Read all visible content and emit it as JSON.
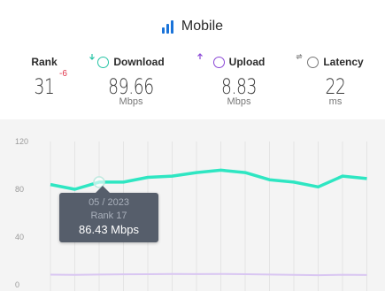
{
  "header": {
    "title": "Mobile",
    "icon": "signal-bars-icon"
  },
  "stats": {
    "rank": {
      "label": "Rank",
      "value": "31",
      "delta": "-6"
    },
    "download": {
      "label": "Download",
      "value": "89.66",
      "unit": "Mbps",
      "icon": "arrow-down-circle-icon",
      "color": "#27c4a5"
    },
    "upload": {
      "label": "Upload",
      "value": "8.83",
      "unit": "Mbps",
      "icon": "arrow-up-circle-icon",
      "color": "#8a47d6"
    },
    "latency": {
      "label": "Latency",
      "value": "22",
      "unit": "ms",
      "icon": "latency-circle-icon",
      "color": "#777777"
    }
  },
  "tooltip": {
    "date": "05 / 2023",
    "rank": "Rank 17",
    "value": "86.43 Mbps"
  },
  "chart_data": {
    "type": "line",
    "ylim": [
      0,
      120
    ],
    "y_ticks": [
      "120",
      "80",
      "40",
      "0"
    ],
    "grid": true,
    "series": [
      {
        "color": "#2ee6c2",
        "values": [
          84,
          80,
          86,
          86,
          90,
          91,
          94,
          96,
          94,
          88,
          86,
          82,
          91,
          89
        ]
      },
      {
        "color": "#d9c6f2",
        "values": [
          8.5,
          8.3,
          8.6,
          8.8,
          8.9,
          9.1,
          9.0,
          9.1,
          8.9,
          8.6,
          8.3,
          8.1,
          8.4,
          8.2
        ]
      }
    ],
    "highlight_index": 2
  }
}
